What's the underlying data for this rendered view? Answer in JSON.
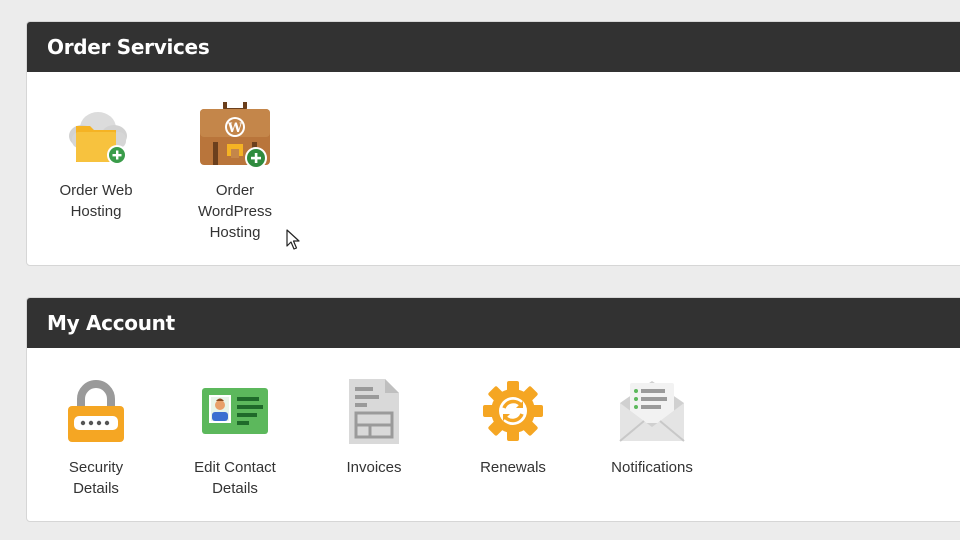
{
  "order_services": {
    "title": "Order Services",
    "items": [
      {
        "label": "Order Web Hosting",
        "icon": "cloud-folder-add-icon"
      },
      {
        "label": "Order WordPress Hosting",
        "icon": "wordpress-briefcase-add-icon"
      }
    ]
  },
  "my_account": {
    "title": "My Account",
    "items": [
      {
        "label": "Security Details",
        "icon": "padlock-icon"
      },
      {
        "label": "Edit Contact Details",
        "icon": "id-card-icon"
      },
      {
        "label": "Invoices",
        "icon": "invoice-document-icon"
      },
      {
        "label": "Renewals",
        "icon": "renew-gear-icon"
      },
      {
        "label": "Notifications",
        "icon": "envelope-icon"
      }
    ]
  },
  "colors": {
    "header_bg": "#323232",
    "add_badge": "#3a9c4a",
    "folder": "#f5b324",
    "briefcase": "#b9753b",
    "padlock": "#f5a623",
    "id_card": "#5cb85c",
    "gear": "#f5a623"
  }
}
